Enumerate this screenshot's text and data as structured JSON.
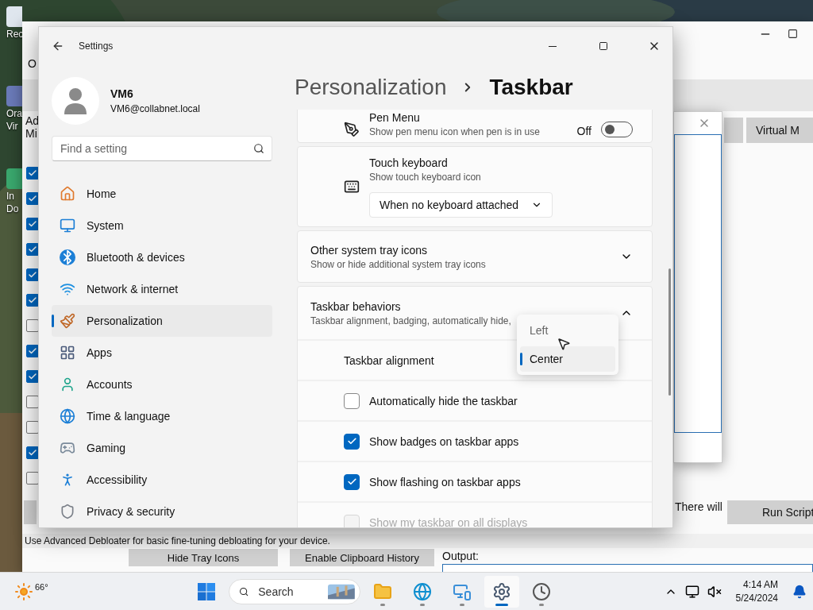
{
  "desktop": {
    "icons": [
      {
        "lines": [
          "Rec"
        ]
      },
      {
        "lines": [
          "Ora",
          "Vir"
        ]
      },
      {
        "lines": [
          "In",
          "Do"
        ]
      }
    ]
  },
  "background_window": {
    "menu": "O",
    "heading_lines": [
      "Ad",
      "Mi"
    ],
    "checkboxes": [
      {
        "checked": true
      },
      {
        "checked": true
      },
      {
        "checked": true
      },
      {
        "checked": true
      },
      {
        "checked": true
      },
      {
        "checked": true
      },
      {
        "checked": false
      },
      {
        "checked": true
      },
      {
        "checked": true
      },
      {
        "checked": false
      },
      {
        "checked": false
      },
      {
        "checked": true
      },
      {
        "checked": false
      }
    ],
    "top_button": "Virtual M",
    "note": "There will",
    "run_button": "Run Script",
    "status": "Use Advanced Debloater for basic fine-tuning debloating for your device.",
    "bottom_buttons": [
      "Hide Tray Icons",
      "Enable Clipboard History"
    ],
    "output_label": "Output:"
  },
  "settings": {
    "title": "Settings",
    "user": {
      "name": "VM6",
      "email": "VM6@collabnet.local"
    },
    "search": {
      "placeholder": "Find a setting"
    },
    "nav": [
      {
        "label": "Home",
        "selected": false
      },
      {
        "label": "System",
        "selected": false
      },
      {
        "label": "Bluetooth & devices",
        "selected": false
      },
      {
        "label": "Network & internet",
        "selected": false
      },
      {
        "label": "Personalization",
        "selected": true
      },
      {
        "label": "Apps",
        "selected": false
      },
      {
        "label": "Accounts",
        "selected": false
      },
      {
        "label": "Time & language",
        "selected": false
      },
      {
        "label": "Gaming",
        "selected": false
      },
      {
        "label": "Accessibility",
        "selected": false
      },
      {
        "label": "Privacy & security",
        "selected": false
      }
    ],
    "breadcrumb": [
      "Personalization",
      "Taskbar"
    ],
    "pen_menu": {
      "title": "Pen Menu",
      "description": "Show pen menu icon when pen is in use",
      "state_label": "Off",
      "on": false
    },
    "touch_keyboard": {
      "title": "Touch keyboard",
      "description": "Show touch keyboard icon",
      "value": "When no keyboard attached"
    },
    "tray_icons": {
      "title": "Other system tray icons",
      "description": "Show or hide additional system tray icons",
      "expanded": false
    },
    "behaviors": {
      "title": "Taskbar behaviors",
      "description": "Taskbar alignment, badging, automatically hide,",
      "expanded": true,
      "alignment_label": "Taskbar alignment",
      "options": [
        {
          "label": "Left",
          "selected": false
        },
        {
          "label": "Center",
          "selected": true
        }
      ],
      "checks": [
        {
          "label": "Automatically hide the taskbar",
          "checked": false,
          "disabled": false
        },
        {
          "label": "Show badges on taskbar apps",
          "checked": true,
          "disabled": false
        },
        {
          "label": "Show flashing on taskbar apps",
          "checked": true,
          "disabled": false
        },
        {
          "label": "Show my taskbar on all displays",
          "checked": false,
          "disabled": true
        }
      ]
    }
  },
  "taskbar": {
    "weather": "66°",
    "search_placeholder": "Search",
    "apps": [
      {
        "kind": "explorer",
        "active": false
      },
      {
        "kind": "edge",
        "active": false
      },
      {
        "kind": "control",
        "active": false
      },
      {
        "kind": "settings",
        "active": true
      },
      {
        "kind": "tool",
        "active": false
      }
    ],
    "time": "4:14 AM",
    "date": "5/24/2024"
  }
}
